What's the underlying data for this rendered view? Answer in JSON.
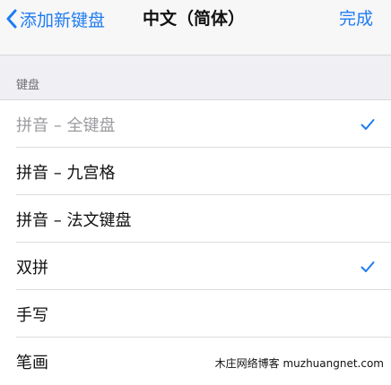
{
  "nav": {
    "back_label": "添加新键盘",
    "title": "中文（简体）",
    "done_label": "完成"
  },
  "section": {
    "header": "键盘"
  },
  "keyboards": [
    {
      "label": "拼音 – 全键盘",
      "checked": true,
      "dimmed": true
    },
    {
      "label": "拼音 – 九宫格",
      "checked": false,
      "dimmed": false
    },
    {
      "label": "拼音 – 法文键盘",
      "checked": false,
      "dimmed": false
    },
    {
      "label": "双拼",
      "checked": true,
      "dimmed": false
    },
    {
      "label": "手写",
      "checked": false,
      "dimmed": false
    },
    {
      "label": "笔画",
      "checked": false,
      "dimmed": false
    }
  ],
  "watermark": "木庄网络博客 muzhuangnet.com",
  "colors": {
    "accent": "#1e7cf2",
    "background": "#efeff4",
    "dimmed_text": "#9b9ba0"
  }
}
